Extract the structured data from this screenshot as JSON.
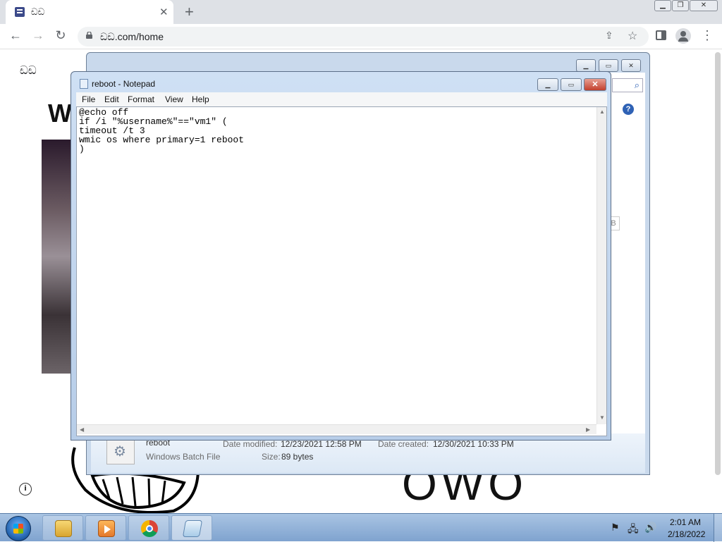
{
  "browser": {
    "tab_title": "ඩඩ",
    "tab_close": "✕",
    "new_tab": "+",
    "url": "ඩඩ.com/home",
    "back": "←",
    "forward": "→",
    "reload": "↻"
  },
  "page": {
    "logo_text": "ඩඩ",
    "big_text_fragment": "W",
    "owo_text": "OWO",
    "info_icon": "i"
  },
  "explorer": {
    "file_name": "reboot",
    "file_type": "Windows Batch File",
    "date_modified_label": "Date modified:",
    "date_modified": "12/23/2021 12:58 PM",
    "date_created_label": "Date created:",
    "date_created": "12/30/2021 10:33 PM",
    "size_label": "Size:",
    "size": "89 bytes"
  },
  "notepad": {
    "title": "reboot - Notepad",
    "menu": [
      "File",
      "Edit",
      "Format",
      "View",
      "Help"
    ],
    "content": "@echo off\nif /i \"%username%\"==\"vm1\" (\ntimeout /t 3\nwmic os where primary=1 reboot\n)"
  },
  "taskbar": {
    "time": "2:01 AM",
    "date": "2/18/2022"
  }
}
